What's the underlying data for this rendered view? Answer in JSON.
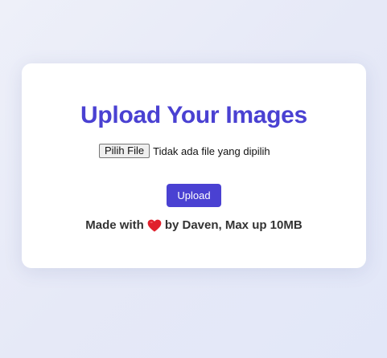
{
  "card": {
    "title": "Upload Your Images",
    "file_input": {
      "button_label": "Pilih File",
      "status_text": "Tidak ada file yang dipilih"
    },
    "upload_button_label": "Upload",
    "footer": {
      "prefix": "Made with",
      "heart_icon": "heart-icon",
      "suffix": "by Daven, Max up 10MB"
    }
  },
  "colors": {
    "accent": "#4a41d2",
    "heart": "#e0202c",
    "background": "#e6e9f7"
  }
}
